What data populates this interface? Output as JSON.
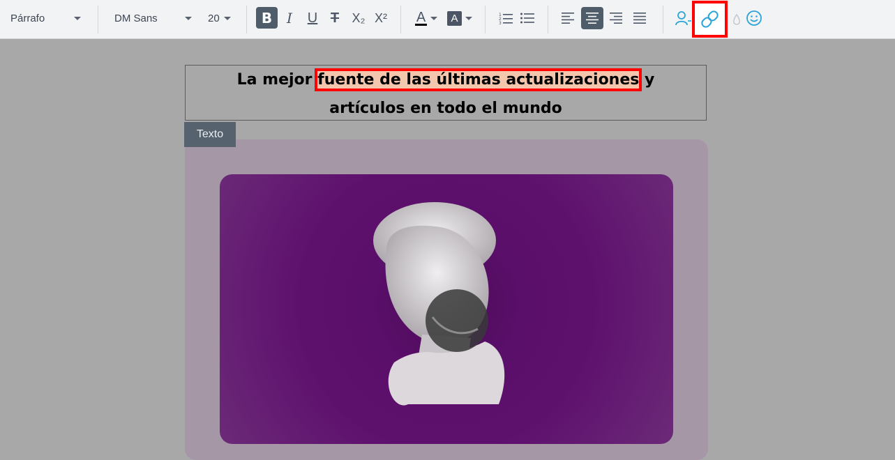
{
  "toolbar": {
    "paragraph_style": "Párrafo",
    "font_family": "DM Sans",
    "font_size": "20",
    "bold_glyph": "B",
    "italic_glyph": "I",
    "underline_glyph": "U",
    "strike_glyph": "T",
    "subscript_glyph": "X₂",
    "superscript_glyph": "X²",
    "text_color_glyph": "A",
    "highlight_color_glyph": "A"
  },
  "editor": {
    "headline_before": "La mejor ",
    "headline_highlight": "fuente de las últimas actualizaciones",
    "headline_after": " y",
    "headline_line2": "artículos en todo el mundo",
    "block_tag": "Texto"
  },
  "colors": {
    "highlight_outline": "#ff0000",
    "accent_icon": "#2aa3d9",
    "image_bg": "#5e106d"
  }
}
